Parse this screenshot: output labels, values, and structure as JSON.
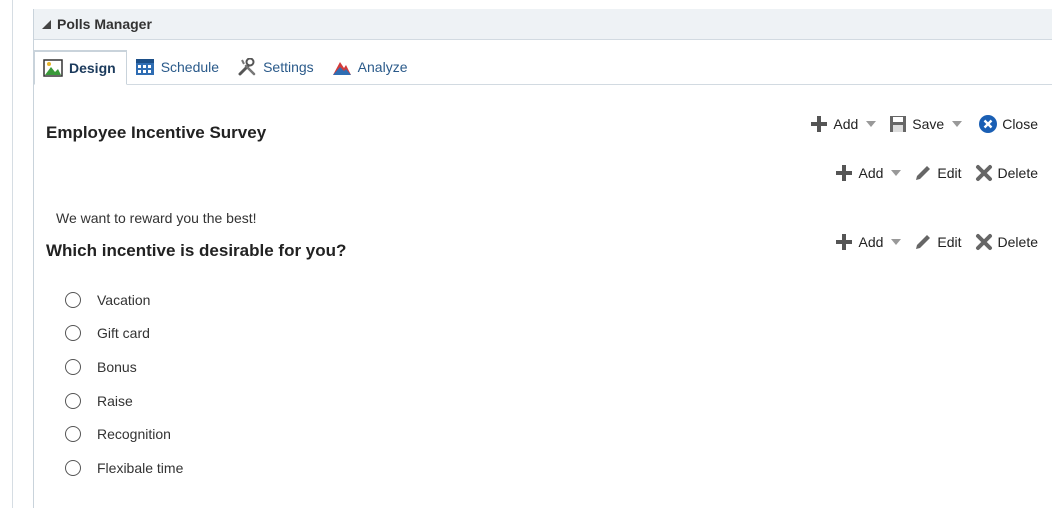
{
  "panel": {
    "title": "Polls Manager"
  },
  "tabs": [
    {
      "label": "Design",
      "icon": "design-icon",
      "active": true
    },
    {
      "label": "Schedule",
      "icon": "calendar-icon",
      "active": false
    },
    {
      "label": "Settings",
      "icon": "tools-icon",
      "active": false
    },
    {
      "label": "Analyze",
      "icon": "chart-mountain-icon",
      "active": false
    }
  ],
  "survey": {
    "title": "Employee Incentive Survey",
    "toolbar": {
      "add": "Add",
      "save": "Save",
      "close": "Close"
    },
    "section_toolbar": {
      "add": "Add",
      "edit": "Edit",
      "delete": "Delete"
    },
    "description": "We want to reward you the best!"
  },
  "question": {
    "text": "Which incentive is desirable for you?",
    "toolbar": {
      "add": "Add",
      "edit": "Edit",
      "delete": "Delete"
    },
    "options": [
      "Vacation",
      "Gift card",
      "Bonus",
      "Raise",
      "Recognition",
      "Flexibale time"
    ]
  },
  "colors": {
    "accent": "#2a5a8a",
    "close_icon": "#1a5fb4",
    "header_bg": "#eef2f5"
  }
}
